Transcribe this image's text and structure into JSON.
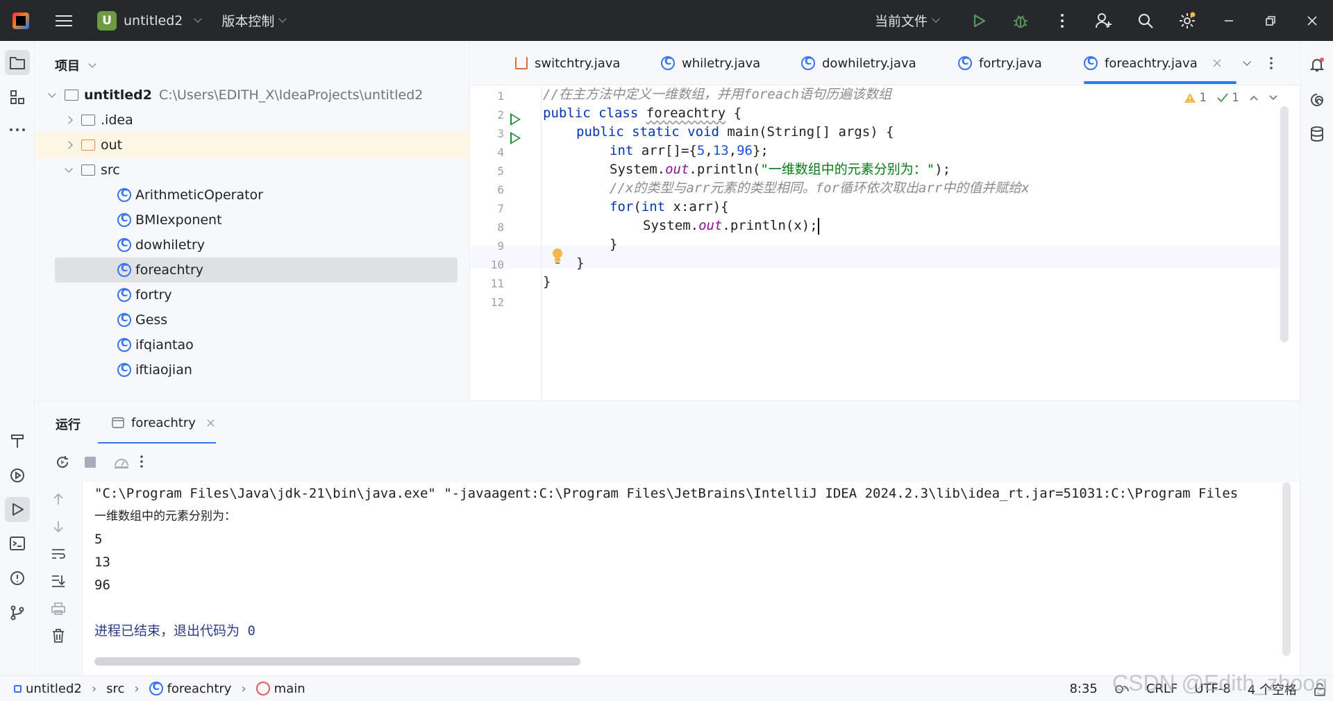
{
  "titlebar": {
    "project_initial": "U",
    "project_name": "untitled2",
    "vcs_label": "版本控制",
    "run_config": "当前文件"
  },
  "project_panel": {
    "title": "项目",
    "root_name": "untitled2",
    "root_path": "C:\\Users\\EDITH_X\\IdeaProjects\\untitled2",
    "items": [
      {
        "label": ".idea"
      },
      {
        "label": "out"
      },
      {
        "label": "src"
      },
      {
        "label": "ArithmeticOperator"
      },
      {
        "label": "BMIexponent"
      },
      {
        "label": "dowhiletry"
      },
      {
        "label": "foreachtry"
      },
      {
        "label": "fortry"
      },
      {
        "label": "Gess"
      },
      {
        "label": "ifqiantao"
      },
      {
        "label": "iftiaojian"
      }
    ]
  },
  "tabs": [
    {
      "label": "switchtry.java"
    },
    {
      "label": "whiletry.java"
    },
    {
      "label": "dowhiletry.java"
    },
    {
      "label": "fortry.java"
    },
    {
      "label": "foreachtry.java"
    }
  ],
  "editor": {
    "line_numbers": [
      "1",
      "2",
      "3",
      "4",
      "5",
      "6",
      "7",
      "8",
      "9",
      "10",
      "11",
      "12"
    ],
    "warnings": "1",
    "checks": "1",
    "lines": {
      "l1_comment": "//在主方法中定义一维数组，并用foreach语句历遍该数组",
      "l2_public": "public",
      "l2_class": "class",
      "l2_name": "foreachtry",
      "l2_brace": " {",
      "l3_mods": "public static void",
      "l3_rest": " main(String[] args) {",
      "l4_int": "int",
      "l4_a": " arr[]={",
      "l4_n1": "5",
      "l4_c1": ",",
      "l4_n2": "13",
      "l4_c2": ",",
      "l4_n3": "96",
      "l4_end": "};",
      "l5_sys": "System.",
      "l5_out": "out",
      "l5_println": ".println(",
      "l5_str": "\"一维数组中的元素分别为：\"",
      "l5_end": ");",
      "l6_comment": "//x的类型与arr元素的类型相同。for循环依次取出arr中的值并赋给x",
      "l7_for": "for",
      "l7_p": "(",
      "l7_int": "int",
      "l7_rest": " x:arr){",
      "l8_sys": "System.",
      "l8_out": "out",
      "l8_rest": ".println(x);",
      "l9": "}",
      "l10": "}",
      "l11": "}"
    }
  },
  "run_panel": {
    "title": "运行",
    "tab_label": "foreachtry",
    "console": [
      "\"C:\\Program Files\\Java\\jdk-21\\bin\\java.exe\" \"-javaagent:C:\\Program Files\\JetBrains\\IntelliJ IDEA 2024.2.3\\lib\\idea_rt.jar=51031:C:\\Program Files",
      "一维数组中的元素分别为：",
      "5",
      "13",
      "96",
      "",
      "进程已结束，退出代码为 0"
    ]
  },
  "statusbar": {
    "crumbs": [
      "untitled2",
      "src",
      "foreachtry",
      "main"
    ],
    "position": "8:35",
    "line_sep": "CRLF",
    "encoding": "UTF-8",
    "indent": "4 个空格",
    "watermark": "CSDN @Edith_zhoog"
  },
  "colors": {
    "accent": "#3574f0",
    "run_green": "#1f8a35",
    "keyword": "#0033b3",
    "string": "#067d17",
    "number": "#1750eb",
    "field": "#871094",
    "comment": "#8c8c8c"
  }
}
